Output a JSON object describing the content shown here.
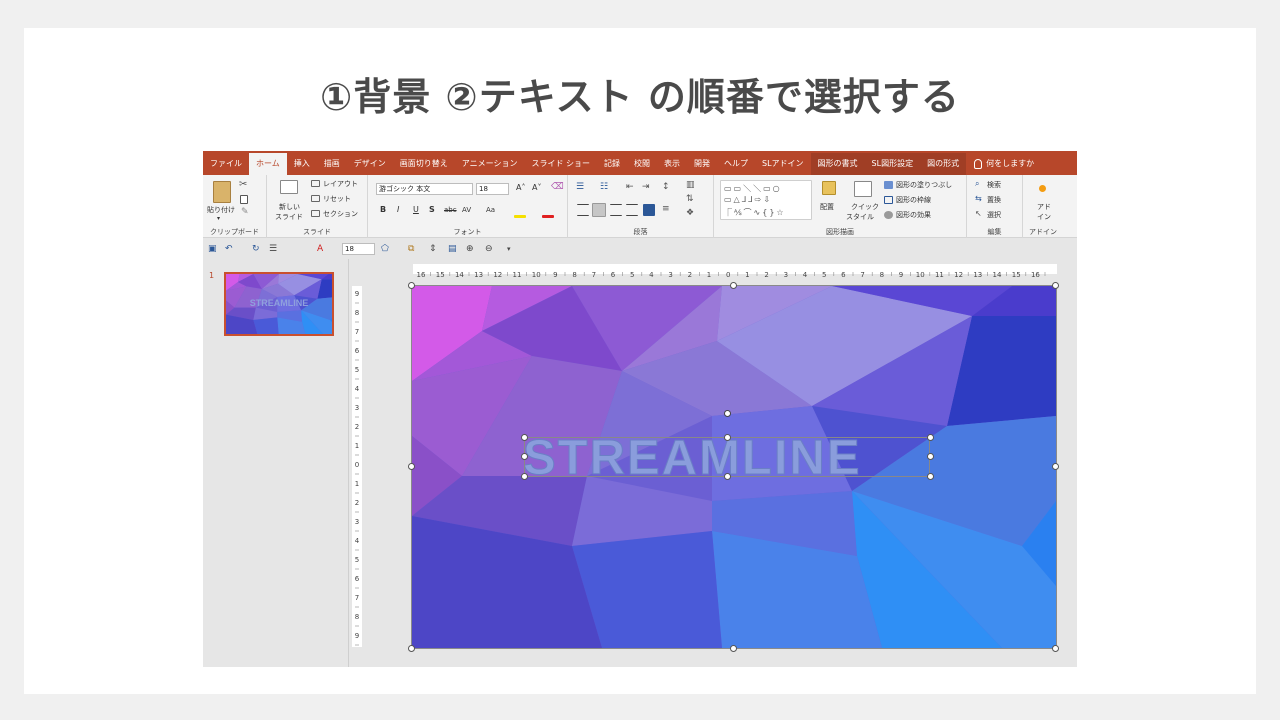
{
  "headline": "①背景 ②テキスト の順番で選択する",
  "colors": {
    "accent": "#b7472a",
    "card": "#ffffff",
    "page": "#f0f0f0"
  },
  "tabs": [
    {
      "label": "ファイル",
      "active": false
    },
    {
      "label": "ホーム",
      "active": true
    },
    {
      "label": "挿入",
      "active": false
    },
    {
      "label": "描画",
      "active": false
    },
    {
      "label": "デザイン",
      "active": false
    },
    {
      "label": "画面切り替え",
      "active": false
    },
    {
      "label": "アニメーション",
      "active": false
    },
    {
      "label": "スライド ショー",
      "active": false
    },
    {
      "label": "記録",
      "active": false
    },
    {
      "label": "校閲",
      "active": false
    },
    {
      "label": "表示",
      "active": false
    },
    {
      "label": "開発",
      "active": false
    },
    {
      "label": "ヘルプ",
      "active": false
    },
    {
      "label": "SLアドイン",
      "active": false
    },
    {
      "label": "図形の書式",
      "active": false,
      "contextual": true
    },
    {
      "label": "SL図形設定",
      "active": false,
      "contextual": true
    },
    {
      "label": "図の形式",
      "active": false,
      "contextual": true
    }
  ],
  "tell_me": "何をしますか",
  "ribbon": {
    "clipboard": {
      "paste": "貼り付け",
      "label": "クリップボード"
    },
    "slides": {
      "new_slide_1": "新しい",
      "new_slide_2": "スライド",
      "layout": "レイアウト",
      "reset": "リセット",
      "section": "セクション",
      "label": "スライド"
    },
    "font": {
      "font_name": "游ゴシック 本文",
      "font_size": "18",
      "bold": "B",
      "italic": "I",
      "underline": "U",
      "shadow": "S",
      "strike": "abc",
      "spacing": "AV",
      "case": "Aa",
      "label": "フォント"
    },
    "paragraph": {
      "label": "段落"
    },
    "drawing": {
      "arrange": "配置",
      "quick_style_1": "クイック",
      "quick_style_2": "スタイル",
      "fill": "図形の塗りつぶし",
      "outline": "図形の枠線",
      "effect": "図形の効果",
      "label": "図形描画"
    },
    "editing": {
      "find": "検索",
      "replace": "置換",
      "select": "選択",
      "label": "編集"
    },
    "addin": {
      "addin_1": "アド",
      "addin_2": "イン",
      "label": "アドイン"
    }
  },
  "qat": {
    "font_size": "18"
  },
  "thumbnail": {
    "number": "1",
    "text": "STREAMLINE"
  },
  "hruler_labels": [
    "16",
    "15",
    "14",
    "13",
    "12",
    "11",
    "10",
    "9",
    "8",
    "7",
    "6",
    "5",
    "4",
    "3",
    "2",
    "1",
    "0",
    "1",
    "2",
    "3",
    "4",
    "5",
    "6",
    "7",
    "8",
    "9",
    "10",
    "11",
    "12",
    "13",
    "14",
    "15",
    "16"
  ],
  "vruler_labels": [
    "9",
    "8",
    "7",
    "6",
    "5",
    "4",
    "3",
    "2",
    "1",
    "0",
    "1",
    "2",
    "3",
    "4",
    "5",
    "6",
    "7",
    "8",
    "9"
  ],
  "slide": {
    "title_text": "STREAMLINE"
  }
}
